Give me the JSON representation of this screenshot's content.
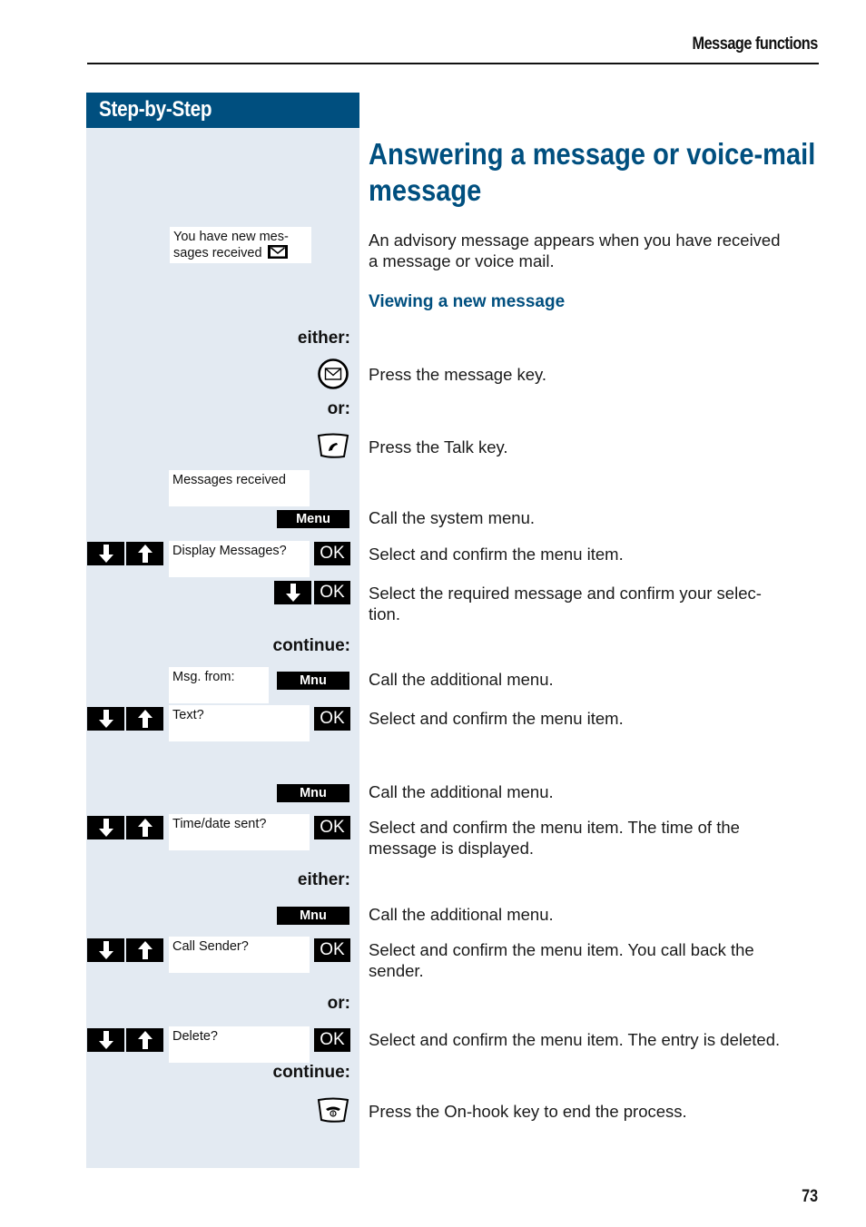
{
  "header": {
    "section_title": "Message functions",
    "page_number": "73"
  },
  "sidebar": {
    "title": "Step-by-Step"
  },
  "main": {
    "title_line1": "Answering a message or voice-mail",
    "title_line2": "message",
    "intro_line1": "An advisory message appears when you have received",
    "intro_line2": "a message or voice mail.",
    "subheading": "Viewing a new message"
  },
  "displays": {
    "new_messages_line1": "You have new mes-",
    "new_messages_line2": "sages received",
    "messages_received": "Messages received",
    "display_messages": "Display Messages?",
    "msg_from": "Msg. from:",
    "text": "Text?",
    "time_date_sent": "Time/date sent?",
    "call_sender": "Call Sender?",
    "delete": "Delete?"
  },
  "labels": {
    "either": "either:",
    "or": "or:",
    "continue": "continue:"
  },
  "keys": {
    "menu": "Menu",
    "mnu": "Mnu",
    "ok": "OK"
  },
  "icons": {
    "message_key": "envelope-circle-icon",
    "talk_key": "talk-key-icon",
    "onhook_key": "onhook-key-icon",
    "down_arrow": "arrow-down-icon",
    "up_arrow": "arrow-up-icon",
    "envelope_small": "envelope-icon"
  },
  "steps": {
    "press_message_key": "Press the message key.",
    "press_talk_key": "Press the Talk key.",
    "call_system_menu": "Call the system menu.",
    "select_confirm": "Select and confirm the menu item.",
    "select_required_line1": "Select the required message and confirm your selec-",
    "select_required_line2": "tion.",
    "call_additional_menu": "Call the additional menu.",
    "select_confirm_time_line1": "Select and confirm the menu item. The time of the",
    "select_confirm_time_line2": "message is displayed.",
    "select_confirm_call_line1": "Select and confirm the menu item. You call back the",
    "select_confirm_call_line2": "sender.",
    "select_confirm_delete": "Select and confirm the menu item. The entry is deleted.",
    "press_onhook": "Press the On-hook key to end the process."
  },
  "colors": {
    "brand_blue": "#004f7f",
    "sidebar_bg": "#e3eaf2",
    "key_black": "#000000"
  }
}
